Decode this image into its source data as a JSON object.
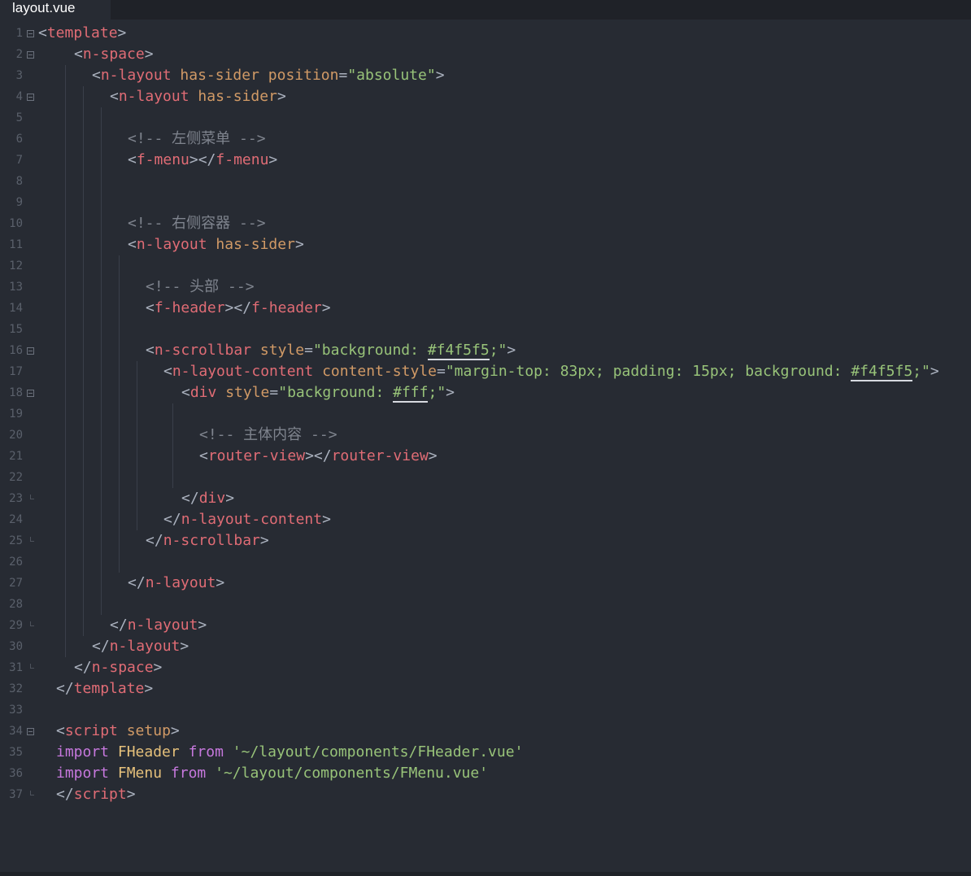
{
  "tab": {
    "filename": "layout.vue"
  },
  "lines": [
    {
      "n": "1",
      "fold": "open",
      "indent": 0,
      "tokens": [
        [
          "pn",
          "<"
        ],
        [
          "tg",
          "template"
        ],
        [
          "pn",
          ">"
        ]
      ]
    },
    {
      "n": "2",
      "fold": "open",
      "indent": 2,
      "tokens": [
        [
          "pn",
          "<"
        ],
        [
          "tg",
          "n-space"
        ],
        [
          "pn",
          ">"
        ]
      ]
    },
    {
      "n": "3",
      "fold": "",
      "indent": 3,
      "tokens": [
        [
          "pn",
          "<"
        ],
        [
          "tg",
          "n-layout"
        ],
        [
          "pn",
          " "
        ],
        [
          "at",
          "has-sider"
        ],
        [
          "pn",
          " "
        ],
        [
          "at",
          "position"
        ],
        [
          "pn",
          "="
        ],
        [
          "st",
          "\"absolute\""
        ],
        [
          "pn",
          ">"
        ]
      ]
    },
    {
      "n": "4",
      "fold": "open",
      "indent": 4,
      "tokens": [
        [
          "pn",
          "<"
        ],
        [
          "tg",
          "n-layout"
        ],
        [
          "pn",
          " "
        ],
        [
          "at",
          "has-sider"
        ],
        [
          "pn",
          ">"
        ]
      ]
    },
    {
      "n": "5",
      "fold": "",
      "indent": 5,
      "tokens": []
    },
    {
      "n": "6",
      "fold": "",
      "indent": 5,
      "tokens": [
        [
          "cm",
          "<!-- 左侧菜单 -->"
        ]
      ]
    },
    {
      "n": "7",
      "fold": "",
      "indent": 5,
      "tokens": [
        [
          "pn",
          "<"
        ],
        [
          "tg",
          "f-menu"
        ],
        [
          "pn",
          "></"
        ],
        [
          "tg",
          "f-menu"
        ],
        [
          "pn",
          ">"
        ]
      ]
    },
    {
      "n": "8",
      "fold": "",
      "indent": 5,
      "tokens": []
    },
    {
      "n": "9",
      "fold": "",
      "indent": 5,
      "tokens": []
    },
    {
      "n": "10",
      "fold": "",
      "indent": 5,
      "tokens": [
        [
          "cm",
          "<!-- 右侧容器 -->"
        ]
      ]
    },
    {
      "n": "11",
      "fold": "",
      "indent": 5,
      "tokens": [
        [
          "pn",
          "<"
        ],
        [
          "tg",
          "n-layout"
        ],
        [
          "pn",
          " "
        ],
        [
          "at",
          "has-sider"
        ],
        [
          "pn",
          ">"
        ]
      ]
    },
    {
      "n": "12",
      "fold": "",
      "indent": 6,
      "tokens": []
    },
    {
      "n": "13",
      "fold": "",
      "indent": 6,
      "tokens": [
        [
          "cm",
          "<!-- 头部 -->"
        ]
      ]
    },
    {
      "n": "14",
      "fold": "",
      "indent": 6,
      "tokens": [
        [
          "pn",
          "<"
        ],
        [
          "tg",
          "f-header"
        ],
        [
          "pn",
          "></"
        ],
        [
          "tg",
          "f-header"
        ],
        [
          "pn",
          ">"
        ]
      ]
    },
    {
      "n": "15",
      "fold": "",
      "indent": 6,
      "tokens": []
    },
    {
      "n": "16",
      "fold": "open",
      "indent": 6,
      "tokens": [
        [
          "pn",
          "<"
        ],
        [
          "tg",
          "n-scrollbar"
        ],
        [
          "pn",
          " "
        ],
        [
          "at",
          "style"
        ],
        [
          "pn",
          "="
        ],
        [
          "st",
          "\"background: "
        ],
        [
          "hex",
          "#f4f5f5"
        ],
        [
          "st",
          ";\""
        ],
        [
          "pn",
          ">"
        ]
      ]
    },
    {
      "n": "17",
      "fold": "",
      "indent": 7,
      "tokens": [
        [
          "pn",
          "<"
        ],
        [
          "tg",
          "n-layout-content"
        ],
        [
          "pn",
          " "
        ],
        [
          "at",
          "content-style"
        ],
        [
          "pn",
          "="
        ],
        [
          "st",
          "\"margin-top: 83px; padding: 15px; background: "
        ],
        [
          "hex",
          "#f4f5f5"
        ],
        [
          "st",
          ";\""
        ],
        [
          "pn",
          ">"
        ]
      ]
    },
    {
      "n": "18",
      "fold": "open",
      "indent": 8,
      "tokens": [
        [
          "pn",
          "<"
        ],
        [
          "tg",
          "div"
        ],
        [
          "pn",
          " "
        ],
        [
          "at",
          "style"
        ],
        [
          "pn",
          "="
        ],
        [
          "st",
          "\"background: "
        ],
        [
          "hex",
          "#fff"
        ],
        [
          "st",
          ";\""
        ],
        [
          "pn",
          ">"
        ]
      ]
    },
    {
      "n": "19",
      "fold": "",
      "indent": 9,
      "tokens": []
    },
    {
      "n": "20",
      "fold": "",
      "indent": 9,
      "tokens": [
        [
          "cm",
          "<!-- 主体内容 -->"
        ]
      ]
    },
    {
      "n": "21",
      "fold": "",
      "indent": 9,
      "tokens": [
        [
          "pn",
          "<"
        ],
        [
          "tg",
          "router-view"
        ],
        [
          "pn",
          "></"
        ],
        [
          "tg",
          "router-view"
        ],
        [
          "pn",
          ">"
        ]
      ]
    },
    {
      "n": "22",
      "fold": "",
      "indent": 9,
      "tokens": []
    },
    {
      "n": "23",
      "fold": "end",
      "indent": 8,
      "tokens": [
        [
          "pn",
          "</"
        ],
        [
          "tg",
          "div"
        ],
        [
          "pn",
          ">"
        ]
      ]
    },
    {
      "n": "24",
      "fold": "",
      "indent": 7,
      "tokens": [
        [
          "pn",
          "</"
        ],
        [
          "tg",
          "n-layout-content"
        ],
        [
          "pn",
          ">"
        ]
      ]
    },
    {
      "n": "25",
      "fold": "end",
      "indent": 6,
      "tokens": [
        [
          "pn",
          "</"
        ],
        [
          "tg",
          "n-scrollbar"
        ],
        [
          "pn",
          ">"
        ]
      ]
    },
    {
      "n": "26",
      "fold": "",
      "indent": 6,
      "tokens": []
    },
    {
      "n": "27",
      "fold": "",
      "indent": 5,
      "tokens": [
        [
          "pn",
          "</"
        ],
        [
          "tg",
          "n-layout"
        ],
        [
          "pn",
          ">"
        ]
      ]
    },
    {
      "n": "28",
      "fold": "",
      "indent": 5,
      "tokens": []
    },
    {
      "n": "29",
      "fold": "end",
      "indent": 4,
      "tokens": [
        [
          "pn",
          "</"
        ],
        [
          "tg",
          "n-layout"
        ],
        [
          "pn",
          ">"
        ]
      ]
    },
    {
      "n": "30",
      "fold": "",
      "indent": 3,
      "tokens": [
        [
          "pn",
          "</"
        ],
        [
          "tg",
          "n-layout"
        ],
        [
          "pn",
          ">"
        ]
      ]
    },
    {
      "n": "31",
      "fold": "end",
      "indent": 2,
      "tokens": [
        [
          "pn",
          "</"
        ],
        [
          "tg",
          "n-space"
        ],
        [
          "pn",
          ">"
        ]
      ]
    },
    {
      "n": "32",
      "fold": "",
      "indent": 1,
      "tokens": [
        [
          "pn",
          "</"
        ],
        [
          "tg",
          "template"
        ],
        [
          "pn",
          ">"
        ]
      ]
    },
    {
      "n": "33",
      "fold": "",
      "indent": 1,
      "tokens": []
    },
    {
      "n": "34",
      "fold": "open",
      "indent": 1,
      "tokens": [
        [
          "pn",
          "<"
        ],
        [
          "tg",
          "script"
        ],
        [
          "pn",
          " "
        ],
        [
          "at",
          "setup"
        ],
        [
          "pn",
          ">"
        ]
      ]
    },
    {
      "n": "35",
      "fold": "",
      "indent": 1,
      "tokens": [
        [
          "kw",
          "import"
        ],
        [
          "pn",
          " "
        ],
        [
          "id",
          "FHeader"
        ],
        [
          "pn",
          " "
        ],
        [
          "kw",
          "from"
        ],
        [
          "pn",
          " "
        ],
        [
          "st",
          "'~/layout/components/FHeader.vue'"
        ]
      ]
    },
    {
      "n": "36",
      "fold": "",
      "indent": 1,
      "tokens": [
        [
          "kw",
          "import"
        ],
        [
          "pn",
          " "
        ],
        [
          "id",
          "FMenu"
        ],
        [
          "pn",
          " "
        ],
        [
          "kw",
          "from"
        ],
        [
          "pn",
          " "
        ],
        [
          "st",
          "'~/layout/components/FMenu.vue'"
        ]
      ]
    },
    {
      "n": "37",
      "fold": "end",
      "indent": 1,
      "tokens": [
        [
          "pn",
          "</"
        ],
        [
          "tg",
          "script"
        ],
        [
          "pn",
          ">"
        ]
      ]
    }
  ],
  "guides": [
    {
      "col": 2,
      "from": 3,
      "to": 30
    },
    {
      "col": 3,
      "from": 4,
      "to": 29
    },
    {
      "col": 4,
      "from": 5,
      "to": 28
    },
    {
      "col": 5,
      "from": 12,
      "to": 26
    },
    {
      "col": 6,
      "from": 17,
      "to": 24
    },
    {
      "col": 8,
      "from": 19,
      "to": 22
    }
  ],
  "colors": {
    "background": "#272b33",
    "tag": "#e06c75",
    "attribute": "#d19a66",
    "string": "#98c379",
    "comment": "#7f848e",
    "keyword": "#c678dd",
    "identifier": "#e5c07b"
  }
}
